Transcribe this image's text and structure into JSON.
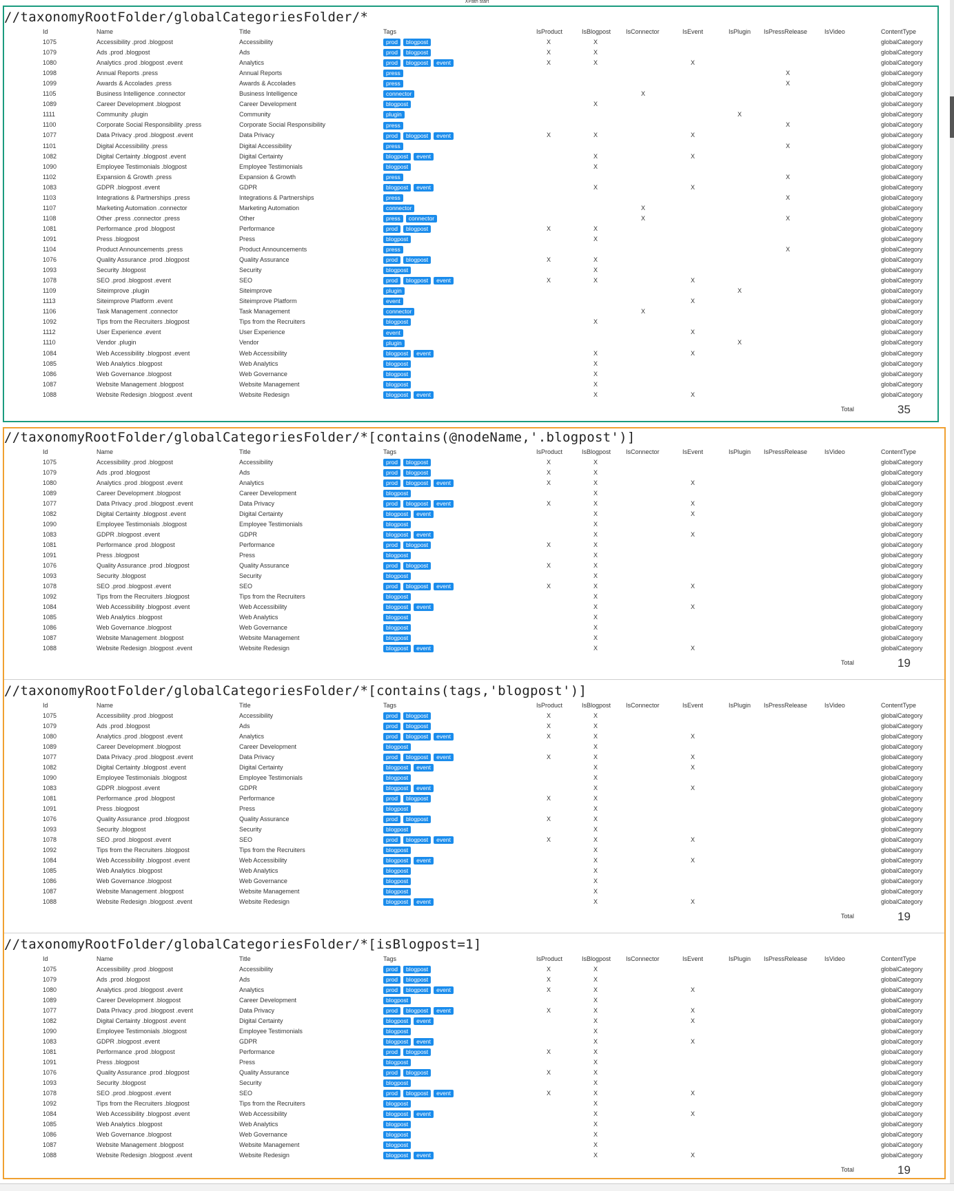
{
  "app": {
    "top_title": "XPath start"
  },
  "columns": [
    "Id",
    "Name",
    "Title",
    "Tags",
    "IsProduct",
    "IsBlogpost",
    "IsConnector",
    "IsEvent",
    "IsPlugin",
    "IsPressRelease",
    "IsVideo",
    "ContentType"
  ],
  "total_label": "Total",
  "content_type": "globalCategory",
  "sections": [
    {
      "xpath": "//taxonomyRootFolder/globalCategoriesFolder/*",
      "total": "35",
      "rows": [
        {
          "id": "1075",
          "name": "Accessibility .prod .blogpost",
          "title": "Accessibility",
          "tags": [
            "prod",
            "blogpost"
          ],
          "flags": [
            "prod",
            "blog"
          ]
        },
        {
          "id": "1079",
          "name": "Ads .prod .blogpost",
          "title": "Ads",
          "tags": [
            "prod",
            "blogpost"
          ],
          "flags": [
            "prod",
            "blog"
          ]
        },
        {
          "id": "1080",
          "name": "Analytics .prod .blogpost .event",
          "title": "Analytics",
          "tags": [
            "prod",
            "blogpost",
            "event"
          ],
          "flags": [
            "prod",
            "blog",
            "event"
          ]
        },
        {
          "id": "1098",
          "name": "Annual Reports .press",
          "title": "Annual Reports",
          "tags": [
            "press"
          ],
          "flags": [
            "press"
          ]
        },
        {
          "id": "1099",
          "name": "Awards & Accolades .press",
          "title": "Awards & Accolades",
          "tags": [
            "press"
          ],
          "flags": [
            "press"
          ]
        },
        {
          "id": "1105",
          "name": "Business Intelligence .connector",
          "title": "Business Intelligence",
          "tags": [
            "connector"
          ],
          "flags": [
            "conn"
          ]
        },
        {
          "id": "1089",
          "name": "Career Development .blogpost",
          "title": "Career Development",
          "tags": [
            "blogpost"
          ],
          "flags": [
            "blog"
          ]
        },
        {
          "id": "1111",
          "name": "Community .plugin",
          "title": "Community",
          "tags": [
            "plugin"
          ],
          "flags": [
            "plug"
          ]
        },
        {
          "id": "1100",
          "name": "Corporate Social Responsibility .press",
          "title": "Corporate Social Responsibility",
          "tags": [
            "press"
          ],
          "flags": [
            "press"
          ]
        },
        {
          "id": "1077",
          "name": "Data Privacy .prod .blogpost .event",
          "title": "Data Privacy",
          "tags": [
            "prod",
            "blogpost",
            "event"
          ],
          "flags": [
            "prod",
            "blog",
            "event"
          ]
        },
        {
          "id": "1101",
          "name": "Digital Accessibility .press",
          "title": "Digital Accessibility",
          "tags": [
            "press"
          ],
          "flags": [
            "press"
          ]
        },
        {
          "id": "1082",
          "name": "Digital Certainty .blogpost .event",
          "title": "Digital Certainty",
          "tags": [
            "blogpost",
            "event"
          ],
          "flags": [
            "blog",
            "event"
          ]
        },
        {
          "id": "1090",
          "name": "Employee Testimonials .blogpost",
          "title": "Employee Testimonials",
          "tags": [
            "blogpost"
          ],
          "flags": [
            "blog"
          ]
        },
        {
          "id": "1102",
          "name": "Expansion & Growth .press",
          "title": "Expansion & Growth",
          "tags": [
            "press"
          ],
          "flags": [
            "press"
          ]
        },
        {
          "id": "1083",
          "name": "GDPR .blogpost .event",
          "title": "GDPR",
          "tags": [
            "blogpost",
            "event"
          ],
          "flags": [
            "blog",
            "event"
          ]
        },
        {
          "id": "1103",
          "name": "Integrations & Partnerships .press",
          "title": "Integrations & Partnerships",
          "tags": [
            "press"
          ],
          "flags": [
            "press"
          ]
        },
        {
          "id": "1107",
          "name": "Marketing Automation .connector",
          "title": "Marketing Automation",
          "tags": [
            "connector"
          ],
          "flags": [
            "conn"
          ]
        },
        {
          "id": "1108",
          "name": "Other .press .connector .press",
          "title": "Other",
          "tags": [
            "press",
            "connector"
          ],
          "flags": [
            "conn",
            "press"
          ]
        },
        {
          "id": "1081",
          "name": "Performance .prod .blogpost",
          "title": "Performance",
          "tags": [
            "prod",
            "blogpost"
          ],
          "flags": [
            "prod",
            "blog"
          ]
        },
        {
          "id": "1091",
          "name": "Press .blogpost",
          "title": "Press",
          "tags": [
            "blogpost"
          ],
          "flags": [
            "blog"
          ]
        },
        {
          "id": "1104",
          "name": "Product Announcements .press",
          "title": "Product Announcements",
          "tags": [
            "press"
          ],
          "flags": [
            "press"
          ]
        },
        {
          "id": "1076",
          "name": "Quality Assurance .prod .blogpost",
          "title": "Quality Assurance",
          "tags": [
            "prod",
            "blogpost"
          ],
          "flags": [
            "prod",
            "blog"
          ]
        },
        {
          "id": "1093",
          "name": "Security .blogpost",
          "title": "Security",
          "tags": [
            "blogpost"
          ],
          "flags": [
            "blog"
          ]
        },
        {
          "id": "1078",
          "name": "SEO .prod .blogpost .event",
          "title": "SEO",
          "tags": [
            "prod",
            "blogpost",
            "event"
          ],
          "flags": [
            "prod",
            "blog",
            "event"
          ]
        },
        {
          "id": "1109",
          "name": "Siteimprove .plugin",
          "title": "Siteimprove",
          "tags": [
            "plugin"
          ],
          "flags": [
            "plug"
          ]
        },
        {
          "id": "1113",
          "name": "Siteimprove Platform .event",
          "title": "Siteimprove Platform",
          "tags": [
            "event"
          ],
          "flags": [
            "event"
          ]
        },
        {
          "id": "1106",
          "name": "Task Management .connector",
          "title": "Task Management",
          "tags": [
            "connector"
          ],
          "flags": [
            "conn"
          ]
        },
        {
          "id": "1092",
          "name": "Tips from the Recruiters .blogpost",
          "title": "Tips from the Recruiters",
          "tags": [
            "blogpost"
          ],
          "flags": [
            "blog"
          ]
        },
        {
          "id": "1112",
          "name": "User Experience .event",
          "title": "User Experience",
          "tags": [
            "event"
          ],
          "flags": [
            "event"
          ]
        },
        {
          "id": "1110",
          "name": "Vendor .plugin",
          "title": "Vendor",
          "tags": [
            "plugin"
          ],
          "flags": [
            "plug"
          ]
        },
        {
          "id": "1084",
          "name": "Web Accessibility .blogpost .event",
          "title": "Web Accessibility",
          "tags": [
            "blogpost",
            "event"
          ],
          "flags": [
            "blog",
            "event"
          ]
        },
        {
          "id": "1085",
          "name": "Web Analytics .blogpost",
          "title": "Web Analytics",
          "tags": [
            "blogpost"
          ],
          "flags": [
            "blog"
          ]
        },
        {
          "id": "1086",
          "name": "Web Governance .blogpost",
          "title": "Web Governance",
          "tags": [
            "blogpost"
          ],
          "flags": [
            "blog"
          ]
        },
        {
          "id": "1087",
          "name": "Website Management .blogpost",
          "title": "Website Management",
          "tags": [
            "blogpost"
          ],
          "flags": [
            "blog"
          ]
        },
        {
          "id": "1088",
          "name": "Website Redesign .blogpost .event",
          "title": "Website Redesign",
          "tags": [
            "blogpost",
            "event"
          ],
          "flags": [
            "blog",
            "event"
          ]
        }
      ]
    },
    {
      "xpath": "//taxonomyRootFolder/globalCategoriesFolder/*[contains(@nodeName,'.blogpost')]",
      "total": "19",
      "rows": "blog19"
    },
    {
      "xpath": "//taxonomyRootFolder/globalCategoriesFolder/*[contains(tags,'blogpost')]",
      "total": "19",
      "rows": "blog19"
    },
    {
      "xpath": "//taxonomyRootFolder/globalCategoriesFolder/*[isBlogpost=1]",
      "total": "19",
      "rows": "blog19"
    }
  ],
  "blog19": [
    {
      "id": "1075",
      "name": "Accessibility .prod .blogpost",
      "title": "Accessibility",
      "tags": [
        "prod",
        "blogpost"
      ],
      "flags": [
        "prod",
        "blog"
      ]
    },
    {
      "id": "1079",
      "name": "Ads .prod .blogpost",
      "title": "Ads",
      "tags": [
        "prod",
        "blogpost"
      ],
      "flags": [
        "prod",
        "blog"
      ]
    },
    {
      "id": "1080",
      "name": "Analytics .prod .blogpost .event",
      "title": "Analytics",
      "tags": [
        "prod",
        "blogpost",
        "event"
      ],
      "flags": [
        "prod",
        "blog",
        "event"
      ]
    },
    {
      "id": "1089",
      "name": "Career Development .blogpost",
      "title": "Career Development",
      "tags": [
        "blogpost"
      ],
      "flags": [
        "blog"
      ]
    },
    {
      "id": "1077",
      "name": "Data Privacy .prod .blogpost .event",
      "title": "Data Privacy",
      "tags": [
        "prod",
        "blogpost",
        "event"
      ],
      "flags": [
        "prod",
        "blog",
        "event"
      ]
    },
    {
      "id": "1082",
      "name": "Digital Certainty .blogpost .event",
      "title": "Digital Certainty",
      "tags": [
        "blogpost",
        "event"
      ],
      "flags": [
        "blog",
        "event"
      ]
    },
    {
      "id": "1090",
      "name": "Employee Testimonials .blogpost",
      "title": "Employee Testimonials",
      "tags": [
        "blogpost"
      ],
      "flags": [
        "blog"
      ]
    },
    {
      "id": "1083",
      "name": "GDPR .blogpost .event",
      "title": "GDPR",
      "tags": [
        "blogpost",
        "event"
      ],
      "flags": [
        "blog",
        "event"
      ]
    },
    {
      "id": "1081",
      "name": "Performance .prod .blogpost",
      "title": "Performance",
      "tags": [
        "prod",
        "blogpost"
      ],
      "flags": [
        "prod",
        "blog"
      ]
    },
    {
      "id": "1091",
      "name": "Press .blogpost",
      "title": "Press",
      "tags": [
        "blogpost"
      ],
      "flags": [
        "blog"
      ]
    },
    {
      "id": "1076",
      "name": "Quality Assurance .prod .blogpost",
      "title": "Quality Assurance",
      "tags": [
        "prod",
        "blogpost"
      ],
      "flags": [
        "prod",
        "blog"
      ]
    },
    {
      "id": "1093",
      "name": "Security .blogpost",
      "title": "Security",
      "tags": [
        "blogpost"
      ],
      "flags": [
        "blog"
      ]
    },
    {
      "id": "1078",
      "name": "SEO .prod .blogpost .event",
      "title": "SEO",
      "tags": [
        "prod",
        "blogpost",
        "event"
      ],
      "flags": [
        "prod",
        "blog",
        "event"
      ]
    },
    {
      "id": "1092",
      "name": "Tips from the Recruiters .blogpost",
      "title": "Tips from the Recruiters",
      "tags": [
        "blogpost"
      ],
      "flags": [
        "blog"
      ]
    },
    {
      "id": "1084",
      "name": "Web Accessibility .blogpost .event",
      "title": "Web Accessibility",
      "tags": [
        "blogpost",
        "event"
      ],
      "flags": [
        "blog",
        "event"
      ]
    },
    {
      "id": "1085",
      "name": "Web Analytics .blogpost",
      "title": "Web Analytics",
      "tags": [
        "blogpost"
      ],
      "flags": [
        "blog"
      ]
    },
    {
      "id": "1086",
      "name": "Web Governance .blogpost",
      "title": "Web Governance",
      "tags": [
        "blogpost"
      ],
      "flags": [
        "blog"
      ]
    },
    {
      "id": "1087",
      "name": "Website Management .blogpost",
      "title": "Website Management",
      "tags": [
        "blogpost"
      ],
      "flags": [
        "blog"
      ]
    },
    {
      "id": "1088",
      "name": "Website Redesign .blogpost .event",
      "title": "Website Redesign",
      "tags": [
        "blogpost",
        "event"
      ],
      "flags": [
        "blog",
        "event"
      ]
    }
  ],
  "x_mark": "X",
  "colors": {
    "panel1_border": "#1a9b7e",
    "panel2_border": "#f0a030",
    "tag_bg": "#1a8cec"
  }
}
